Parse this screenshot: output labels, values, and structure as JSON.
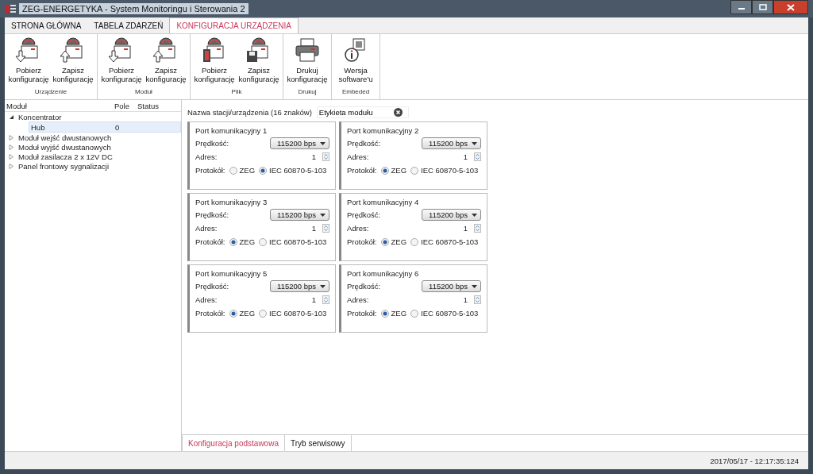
{
  "window": {
    "title": "ZEG-ENERGETYKA - System Monitoringu i Sterowania 2"
  },
  "tabs": [
    {
      "label": "STRONA GŁÓWNA",
      "selected": false
    },
    {
      "label": "TABELA ZDARZEŃ",
      "selected": false
    },
    {
      "label": "KONFIGURACJA URZĄDZENIA",
      "selected": true
    }
  ],
  "ribbon": [
    {
      "group": "Urządzenie",
      "buttons": [
        {
          "kind": "download",
          "line1": "Pobierz",
          "line2": "konfigurację"
        },
        {
          "kind": "upload",
          "line1": "Zapisz",
          "line2": "konfigurację"
        }
      ]
    },
    {
      "group": "Moduł",
      "buttons": [
        {
          "kind": "module-download",
          "line1": "Pobierz",
          "line2": "konfigurację"
        },
        {
          "kind": "module-upload",
          "line1": "Zapisz",
          "line2": "konfigurację"
        }
      ]
    },
    {
      "group": "Plik",
      "buttons": [
        {
          "kind": "file-open",
          "line1": "Pobierz",
          "line2": "konfigurację"
        },
        {
          "kind": "file-save",
          "line1": "Zapisz",
          "line2": "konfigurację"
        }
      ]
    },
    {
      "group": "Drukuj",
      "buttons": [
        {
          "kind": "print",
          "line1": "Drukuj",
          "line2": "konfigurację"
        }
      ]
    },
    {
      "group": "Embeded",
      "buttons": [
        {
          "kind": "info",
          "line1": "Wersja",
          "line2": "software'u"
        }
      ]
    }
  ],
  "tree": {
    "columns": [
      "Moduł",
      "Pole",
      "Status"
    ],
    "items": [
      {
        "label": "Koncentrator",
        "expanded": true,
        "children": [
          {
            "label": "Hub",
            "pole": "0",
            "selected": true
          }
        ]
      },
      {
        "label": "Moduł wejść dwustanowych",
        "expanded": false
      },
      {
        "label": "Moduł wyjść dwustanowych",
        "expanded": false
      },
      {
        "label": "Moduł zasilacza 2 x 12V DC",
        "expanded": false
      },
      {
        "label": "Panel frontowy sygnalizacji",
        "expanded": false
      }
    ]
  },
  "station": {
    "label": "Nazwa stacji/urządzenia (16 znaków)",
    "value": "Etykieta modułu"
  },
  "ports": [
    {
      "title": "Port komunikacyjny 1",
      "speed_label": "Prędkość:",
      "speed": "115200 bps",
      "address_label": "Adres:",
      "address": "1",
      "protocol_label": "Protokół:",
      "options": [
        {
          "label": "ZEG",
          "selected": false
        },
        {
          "label": "IEC 60870-5-103",
          "selected": true
        }
      ]
    },
    {
      "title": "Port komunikacyjny 2",
      "speed_label": "Prędkość:",
      "speed": "115200 bps",
      "address_label": "Adres:",
      "address": "1",
      "protocol_label": "Protokół:",
      "options": [
        {
          "label": "ZEG",
          "selected": true
        },
        {
          "label": "IEC 60870-5-103",
          "selected": false
        }
      ]
    },
    {
      "title": "Port komunikacyjny 3",
      "speed_label": "Prędkość:",
      "speed": "115200 bps",
      "address_label": "Adres:",
      "address": "1",
      "protocol_label": "Protokół:",
      "options": [
        {
          "label": "ZEG",
          "selected": true
        },
        {
          "label": "IEC 60870-5-103",
          "selected": false
        }
      ]
    },
    {
      "title": "Port komunikacyjny 4",
      "speed_label": "Prędkość:",
      "speed": "115200 bps",
      "address_label": "Adres:",
      "address": "1",
      "protocol_label": "Protokół:",
      "options": [
        {
          "label": "ZEG",
          "selected": true
        },
        {
          "label": "IEC 60870-5-103",
          "selected": false
        }
      ]
    },
    {
      "title": "Port komunikacyjny 5",
      "speed_label": "Prędkość:",
      "speed": "115200 bps",
      "address_label": "Adres:",
      "address": "1",
      "protocol_label": "Protokół:",
      "options": [
        {
          "label": "ZEG",
          "selected": true
        },
        {
          "label": "IEC 60870-5-103",
          "selected": false
        }
      ]
    },
    {
      "title": "Port komunikacyjny 6",
      "speed_label": "Prędkość:",
      "speed": "115200 bps",
      "address_label": "Adres:",
      "address": "1",
      "protocol_label": "Protokół:",
      "options": [
        {
          "label": "ZEG",
          "selected": true
        },
        {
          "label": "IEC 60870-5-103",
          "selected": false
        }
      ]
    }
  ],
  "bottom_tabs": [
    {
      "label": "Konfiguracja podstawowa",
      "selected": true
    },
    {
      "label": "Tryb serwisowy",
      "selected": false
    }
  ],
  "status_bar": {
    "timestamp": "2017/05/17 - 12:17:35:124"
  }
}
